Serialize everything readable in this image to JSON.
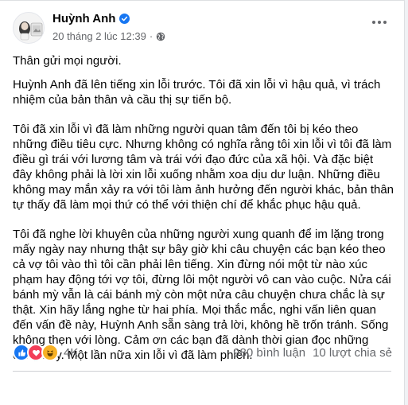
{
  "post": {
    "author": "Huỳnh Anh",
    "timestamp": "20 tháng 2 lúc 12:39",
    "meta_separator": "·",
    "paragraphs": [
      "Thân gửi mọi người.",
      "Huỳnh Anh đã lên tiếng xin lỗi trước. Tôi đã xin lỗi vì hậu quả, vì trách nhiệm của bản thân và cầu thị sự tiến bộ.",
      "Tôi đã xin lỗi vì đã làm những người quan tâm đến tôi bị kéo theo những điều tiêu cực. Nhưng không có nghĩa rằng tôi xin lỗi vì tôi đã làm điều gì trái với lương tâm và trái với đạo đức của xã hội. Và đặc biệt đây không phải là lời xin lỗi xuống nhằm xoa dịu dư luận. Những điều không may mắn xảy ra với tôi làm ảnh hưởng đến người khác, bản thân tự thấy đã làm mọi thứ có thể với thiện chí để khắc phục hậu quả.",
      "Tôi đã nghe lời khuyên của những người xung quanh để im lặng trong mấy ngày nay nhưng thật sự bây giờ khi câu chuyện các bạn kéo theo cả vợ tôi vào thì tôi cần phải lên tiếng. Xin đừng nói một từ nào xúc phạm hay động tới vợ tôi, đừng lôi một người vô can vào cuộc. Nửa cái bánh mỳ vẫn là cái bánh mỳ còn một nửa câu chuyện chưa chắc là sự thật. Xin hãy lắng nghe từ hai phía. Mọi thắc mắc, nghi vấn liên quan đến vấn đề này, Huỳnh Anh sẵn sàng trả lời, không hề trốn tránh. Sống không thẹn với lòng. Cảm ơn các bạn đã dành thời gian đọc những dòng này. Một lần nữa xin lỗi vì đã làm phiền."
    ],
    "reaction_count": "4K",
    "comments": "980 bình luận",
    "shares": "10 lượt chia sẻ",
    "icons": {
      "verified": "verified-badge-icon",
      "audience": "globe-icon",
      "more": "more-options-icon",
      "reactions": [
        "like-reaction-icon",
        "love-reaction-icon",
        "haha-reaction-icon"
      ]
    },
    "colors": {
      "accent": "#1877f2",
      "love": "#f33e58",
      "haha": "#f7b125",
      "secondary_text": "#65676b"
    }
  }
}
